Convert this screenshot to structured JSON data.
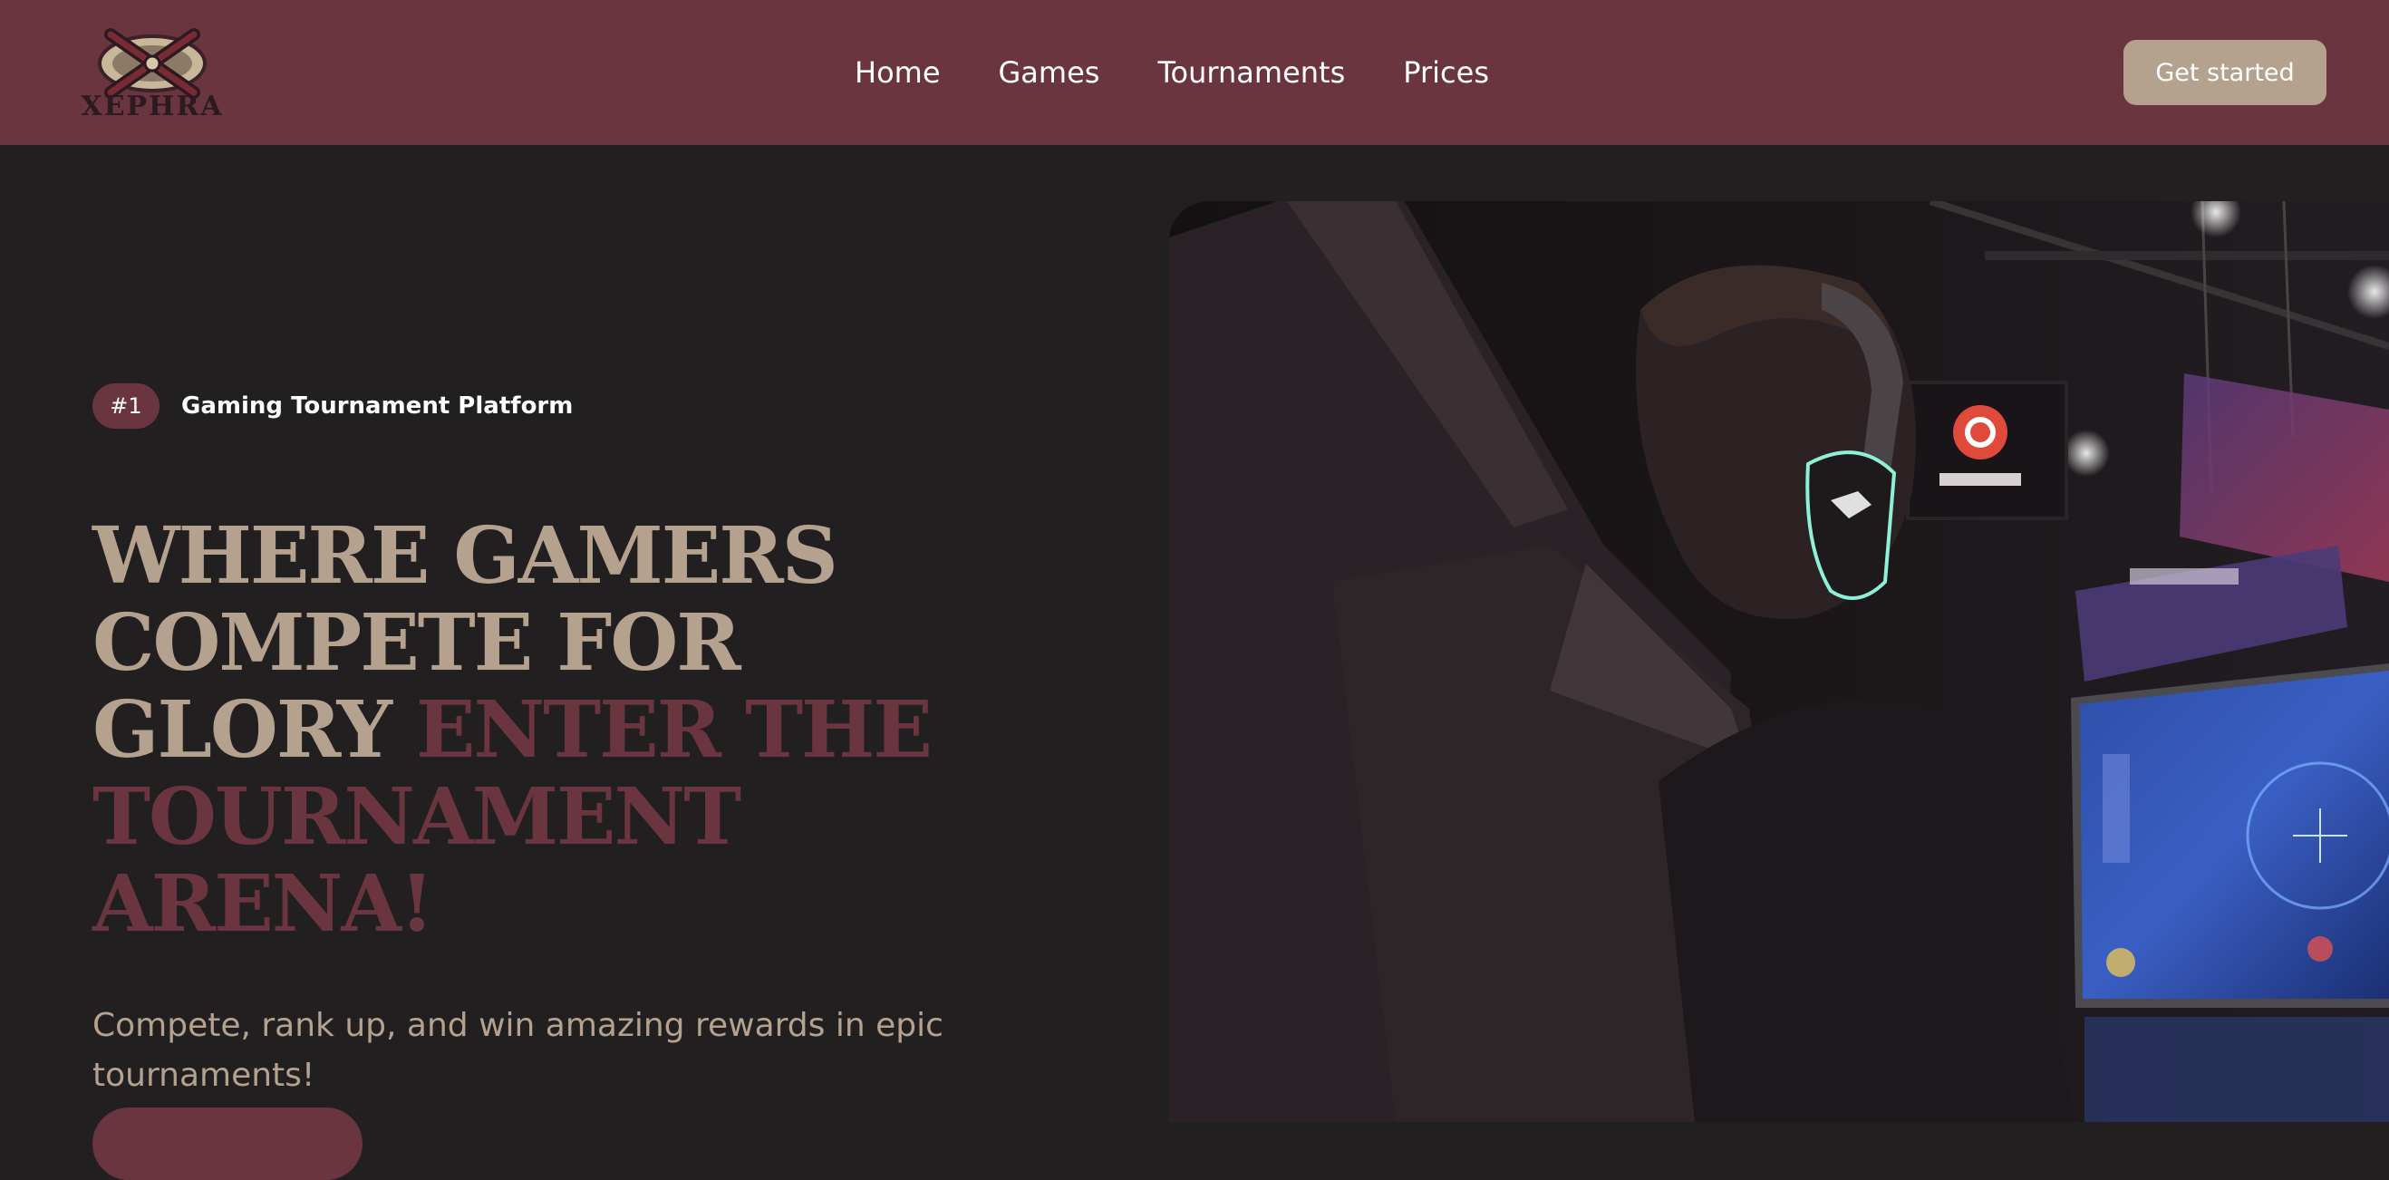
{
  "brand": {
    "logo_text": "XEPHRA",
    "logo_icon": "crossed-swords-shield-icon",
    "accent_color": "#6b3540",
    "tan_color": "#b5a28e",
    "background_color": "#221f21"
  },
  "nav": {
    "links": [
      {
        "label": "Home"
      },
      {
        "label": "Games"
      },
      {
        "label": "Tournaments"
      },
      {
        "label": "Prices"
      }
    ],
    "cta_label": "Get started"
  },
  "hero": {
    "badge": "#1",
    "tagline": "Gaming Tournament Platform",
    "headline_light": "WHERE GAMERS COMPETE FOR GLORY",
    "headline_dark": "ENTER THE TOURNAMENT ARENA!",
    "subtitle": "Compete, rank up, and win amazing rewards in epic tournaments!",
    "image_icon": "gamer-with-headset-photo"
  }
}
